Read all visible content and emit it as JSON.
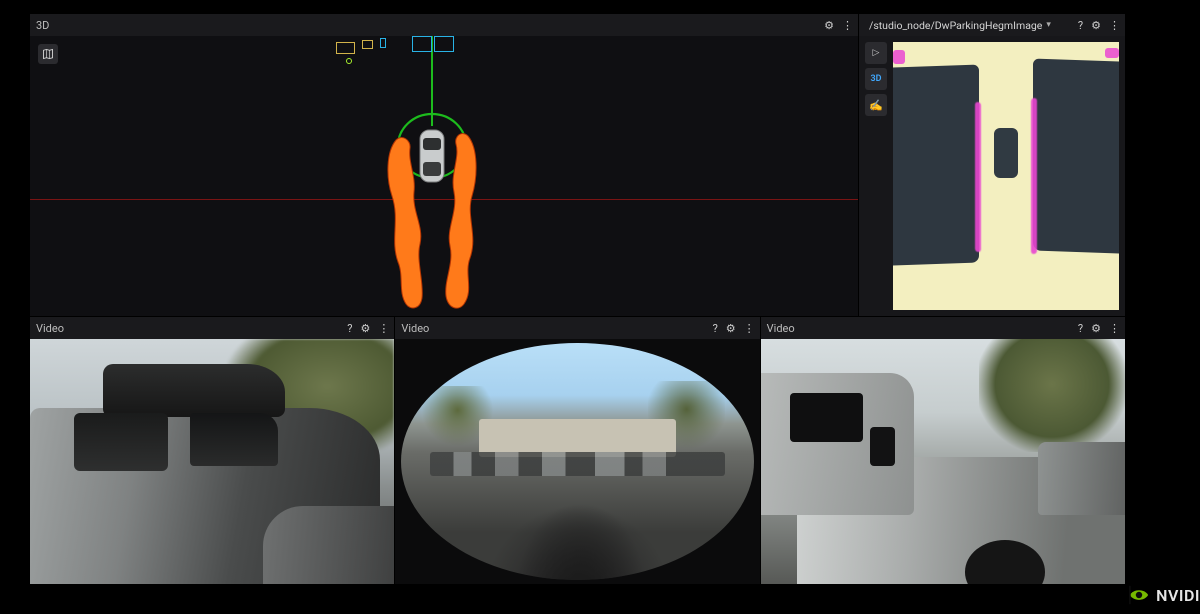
{
  "panels": {
    "viewer3d": {
      "title": "3D"
    },
    "image": {
      "topic": "/studio_node/DwParkingHegmImage"
    },
    "video1": {
      "title": "Video"
    },
    "video2": {
      "title": "Video"
    },
    "video3": {
      "title": "Video"
    }
  },
  "toolbar": {
    "label_3d": "3D"
  },
  "icons": {
    "gear": "⚙",
    "dots": "⋮",
    "help": "?",
    "chevron_down": "▾",
    "play": "▷",
    "marker": "✍"
  },
  "brand": {
    "name": "NVIDI"
  }
}
